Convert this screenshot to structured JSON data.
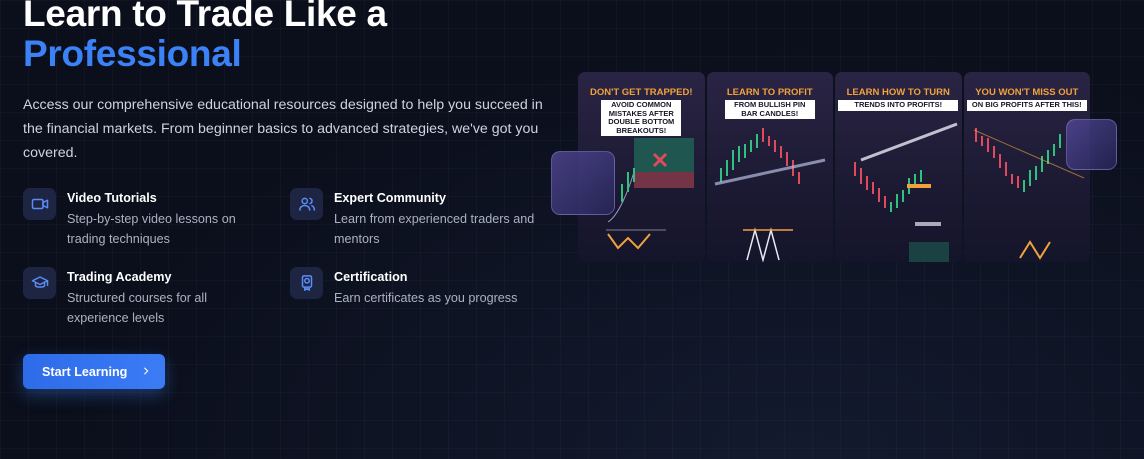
{
  "hero": {
    "title_line1": "Learn to Trade Like a",
    "title_line2": "Professional",
    "description": "Access our comprehensive educational resources designed to help you succeed in the financial markets. From beginner basics to advanced strategies, we've got you covered."
  },
  "features": [
    {
      "icon": "video-camera-icon",
      "title": "Video Tutorials",
      "description": "Step-by-step video lessons on trading techniques"
    },
    {
      "icon": "users-icon",
      "title": "Expert Community",
      "description": "Learn from experienced traders and mentors"
    },
    {
      "icon": "graduation-cap-icon",
      "title": "Trading Academy",
      "description": "Structured courses for all experience levels"
    },
    {
      "icon": "award-icon",
      "title": "Certification",
      "description": "Earn certificates as you progress"
    }
  ],
  "cta": {
    "label": "Start Learning",
    "icon": "chevron-right-icon"
  },
  "gallery": [
    {
      "headline": "DON'T GET TRAPPED!",
      "subhead": "AVOID COMMON MISTAKES AFTER DOUBLE BOTTOM BREAKOUTS!"
    },
    {
      "headline": "LEARN TO PROFIT",
      "subhead": "FROM BULLISH PIN BAR CANDLES!"
    },
    {
      "headline": "LEARN HOW TO TURN",
      "subhead": "TRENDS INTO PROFITS!"
    },
    {
      "headline": "YOU WON'T MISS OUT",
      "subhead": "ON BIG PROFITS AFTER THIS!"
    }
  ],
  "colors": {
    "accent": "#3b82f6",
    "background": "#0b0f1c",
    "icon_bg": "#1d2542",
    "thumb_orange": "#f2a23a"
  }
}
